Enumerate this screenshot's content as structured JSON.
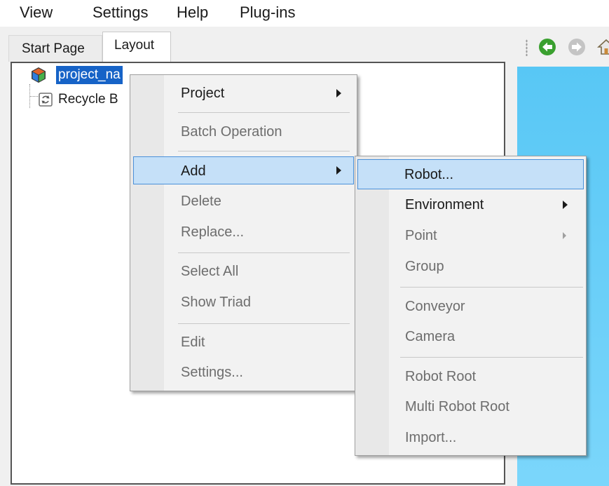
{
  "menubar": {
    "items": [
      "View",
      "Settings",
      "Help",
      "Plug-ins"
    ]
  },
  "tabs": [
    {
      "label": "Start Page",
      "active": false
    },
    {
      "label": "Layout",
      "active": true
    }
  ],
  "tree": {
    "items": [
      {
        "label": "project_na",
        "icon": "project-cube-icon",
        "selected": true
      },
      {
        "label": "Recycle B",
        "icon": "recycle-bin-icon",
        "selected": false
      }
    ]
  },
  "context_menu": {
    "items": [
      {
        "label": "Project",
        "enabled": true,
        "submenu": true
      },
      {
        "label": "Batch Operation",
        "enabled": false
      },
      {
        "label": "Add",
        "enabled": true,
        "submenu": true,
        "highlighted": true
      },
      {
        "label": "Delete",
        "enabled": false
      },
      {
        "label": "Replace...",
        "enabled": false
      },
      {
        "label": "Select All",
        "enabled": false
      },
      {
        "label": "Show Triad",
        "enabled": false
      },
      {
        "label": "Edit",
        "enabled": false
      },
      {
        "label": "Settings...",
        "enabled": false
      }
    ]
  },
  "add_submenu": {
    "items": [
      {
        "label": "Robot...",
        "enabled": true,
        "highlighted": true
      },
      {
        "label": "Environment",
        "enabled": true,
        "submenu": true
      },
      {
        "label": "Point",
        "enabled": false,
        "submenu": true
      },
      {
        "label": "Group",
        "enabled": false
      },
      {
        "label": "Conveyor",
        "enabled": false
      },
      {
        "label": "Camera",
        "enabled": false
      },
      {
        "label": "Robot Root",
        "enabled": false
      },
      {
        "label": "Multi Robot Root",
        "enabled": false
      },
      {
        "label": "Import...",
        "enabled": false
      }
    ]
  },
  "toolbar": {
    "icons": [
      "back-arrow-icon",
      "forward-arrow-icon",
      "home-icon"
    ]
  },
  "colors": {
    "selection": "#1663c7",
    "menu_highlight": "#c5e0f8",
    "menu_highlight_border": "#4a90d9",
    "viewport": "#58c7f5",
    "back_icon": "#3aa02f"
  }
}
